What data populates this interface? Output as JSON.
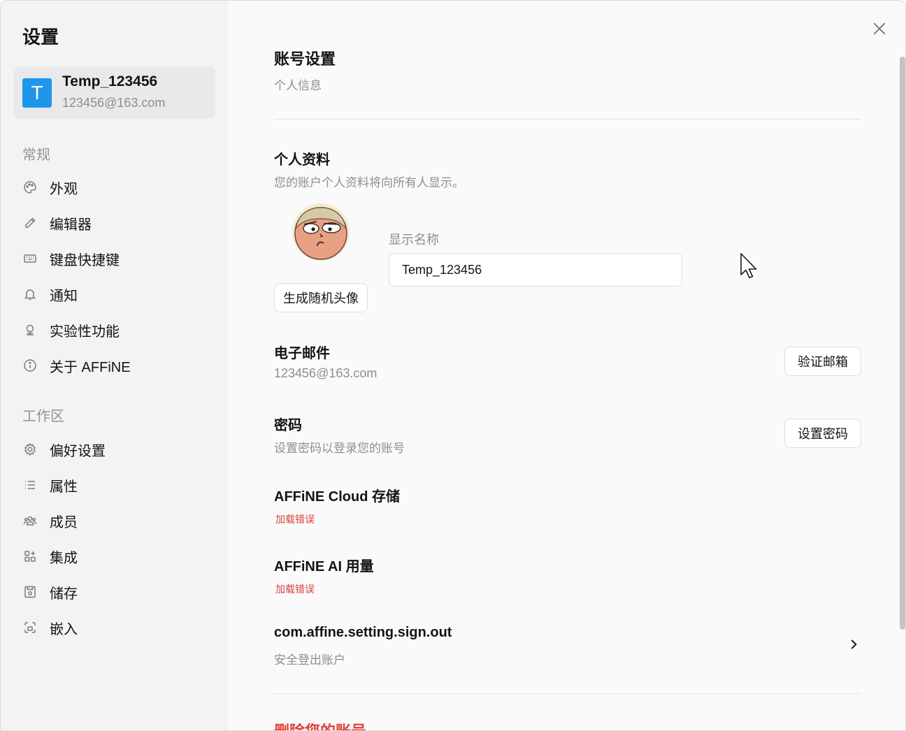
{
  "sidebar": {
    "title": "设置",
    "account": {
      "avatar_letter": "T",
      "name": "Temp_123456",
      "email": "123456@163.com"
    },
    "general_label": "常规",
    "general_items": [
      {
        "label": "外观",
        "icon": "palette-icon"
      },
      {
        "label": "编辑器",
        "icon": "pen-icon"
      },
      {
        "label": "键盘快捷键",
        "icon": "keyboard-icon"
      },
      {
        "label": "通知",
        "icon": "bell-icon"
      },
      {
        "label": "实验性功能",
        "icon": "experiment-icon"
      },
      {
        "label": "关于 AFFiNE",
        "icon": "info-icon"
      }
    ],
    "workspace_label": "工作区",
    "workspace_items": [
      {
        "label": "偏好设置",
        "icon": "gear-icon"
      },
      {
        "label": "属性",
        "icon": "list-icon"
      },
      {
        "label": "成员",
        "icon": "members-icon"
      },
      {
        "label": "集成",
        "icon": "integration-icon"
      },
      {
        "label": "储存",
        "icon": "storage-icon"
      },
      {
        "label": "嵌入",
        "icon": "embed-icon"
      }
    ]
  },
  "main": {
    "title": "账号设置",
    "subtitle": "个人信息",
    "profile": {
      "title": "个人资料",
      "description": "您的账户个人资料将向所有人显示。",
      "random_avatar_button": "生成随机头像",
      "display_name_label": "显示名称",
      "display_name_value": "Temp_123456"
    },
    "email": {
      "title": "电子邮件",
      "value": "123456@163.com",
      "verify_button": "验证邮箱"
    },
    "password": {
      "title": "密码",
      "description": "设置密码以登录您的账号",
      "set_button": "设置密码"
    },
    "cloud_storage": {
      "title": "AFFiNE Cloud 存储",
      "error": "加载错误"
    },
    "ai_usage": {
      "title": "AFFiNE AI 用量",
      "error": "加载错误"
    },
    "sign_out": {
      "title": "com.affine.setting.sign.out",
      "description": "安全登出账户"
    },
    "delete_account": {
      "title": "删除您的账号"
    }
  },
  "colors": {
    "accent": "#1e96eb",
    "danger": "#e0403a"
  }
}
